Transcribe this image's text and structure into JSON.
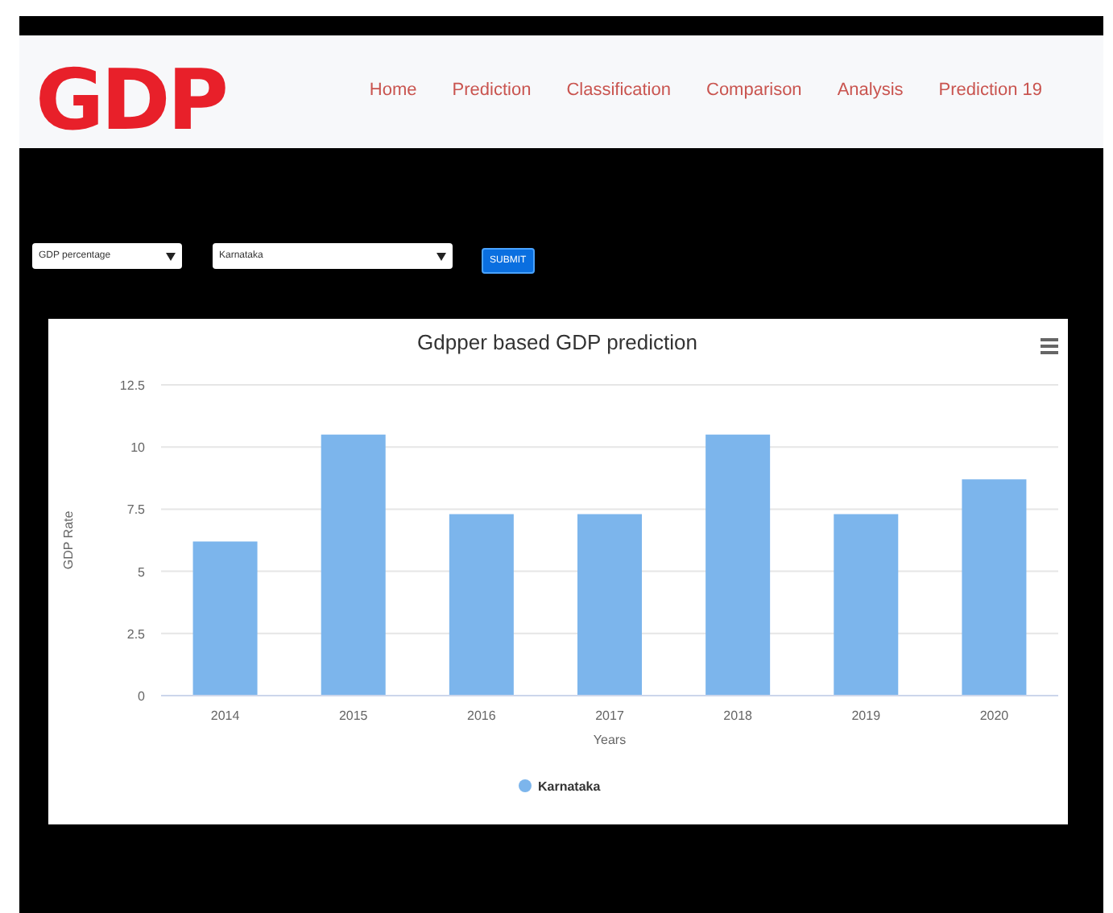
{
  "logo": {
    "text": "GDP"
  },
  "nav": [
    {
      "label": "Home"
    },
    {
      "label": "Prediction"
    },
    {
      "label": "Classification"
    },
    {
      "label": "Comparison"
    },
    {
      "label": "Analysis"
    },
    {
      "label": "Prediction 19"
    }
  ],
  "form": {
    "metric": "GDP percentage",
    "region": "Karnataka",
    "submit": "SUBMIT"
  },
  "chart": {
    "chart_data": {
      "type": "bar",
      "title": "Gdpper based GDP prediction",
      "xlabel": "Years",
      "ylabel": "GDP Rate",
      "categories": [
        "2014",
        "2015",
        "2016",
        "2017",
        "2018",
        "2019",
        "2020"
      ],
      "series": [
        {
          "name": "Karnataka",
          "color": "#7cb5ec",
          "values": [
            6.2,
            10.5,
            7.3,
            7.3,
            10.5,
            7.3,
            8.7
          ]
        }
      ],
      "ylim": [
        0,
        12.5
      ],
      "grid": true,
      "yticks": [
        0,
        {
          "value": 2.5,
          "label": "2.5"
        },
        5,
        {
          "value": 7.5,
          "label": "7.5"
        },
        10,
        {
          "value": 12.5,
          "label": "12.5"
        }
      ]
    }
  }
}
